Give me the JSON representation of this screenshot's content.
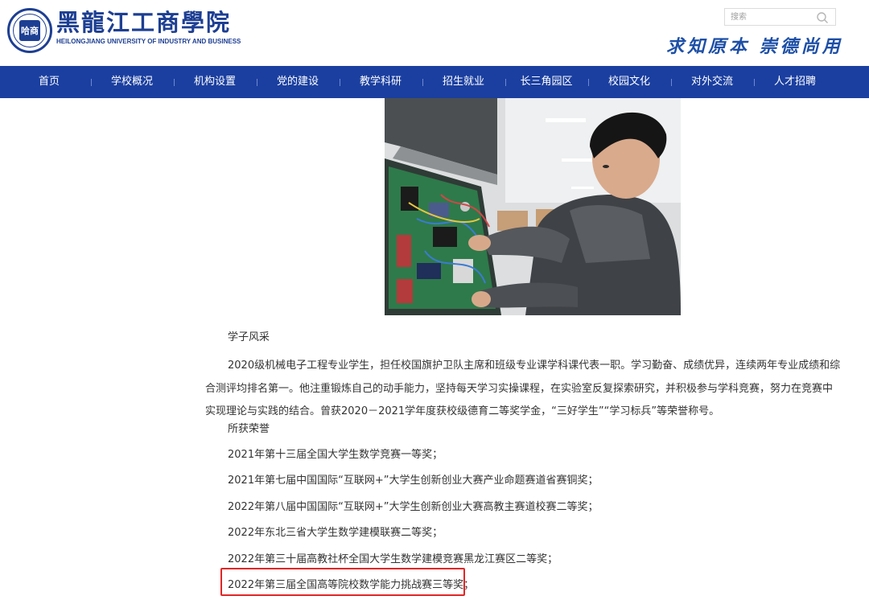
{
  "header": {
    "logo_cn": "黑龍江工商學院",
    "logo_en": "HEILONGJIANG UNIVERSITY OF INDUSTRY AND BUSINESS",
    "logo_seal_glyph": "哈商",
    "motto": "求知原本 崇德尚用",
    "search_placeholder": "搜索"
  },
  "nav": {
    "items": [
      {
        "label": "首页"
      },
      {
        "label": "学校概况"
      },
      {
        "label": "机构设置"
      },
      {
        "label": "党的建设"
      },
      {
        "label": "教学科研"
      },
      {
        "label": "招生就业"
      },
      {
        "label": "长三角园区"
      },
      {
        "label": "校园文化"
      },
      {
        "label": "对外交流"
      },
      {
        "label": "人才招聘"
      }
    ]
  },
  "article": {
    "section_title_1": "学子风采",
    "intro": "2020级机械电子工程专业学生，担任校国旗护卫队主席和班级专业课学科课代表一职。学习勤奋、成绩优异，连续两年专业成绩和综合测评均排名第一。他注重锻炼自己的动手能力，坚持每天学习实操课程，在实验室反复探索研究，并积极参与学科竞赛，努力在竞赛中实现理论与实践的结合。曾获2020－2021学年度获校级德育二等奖学金，“三好学生”“学习标兵”等荣誉称号。",
    "section_title_2": "所获荣誉",
    "honors": [
      "2021年第十三届全国大学生数学竞赛一等奖；",
      "2021年第七届中国国际“互联网+”大学生创新创业大赛产业命题赛道省赛铜奖；",
      "2022年第八届中国国际“互联网+”大学生创新创业大赛高教主赛道校赛二等奖；",
      "2022年东北三省大学生数学建模联赛二等奖；",
      "2022年第三十届高教社杯全国大学生数学建模竞赛黑龙江赛区二等奖；",
      "2022年第三届全国高等院校数学能力挑战赛三等奖；"
    ]
  },
  "colors": {
    "nav_bg": "#1b3fa0",
    "brand_blue": "#1d3f93",
    "highlight_red": "#e02626"
  }
}
